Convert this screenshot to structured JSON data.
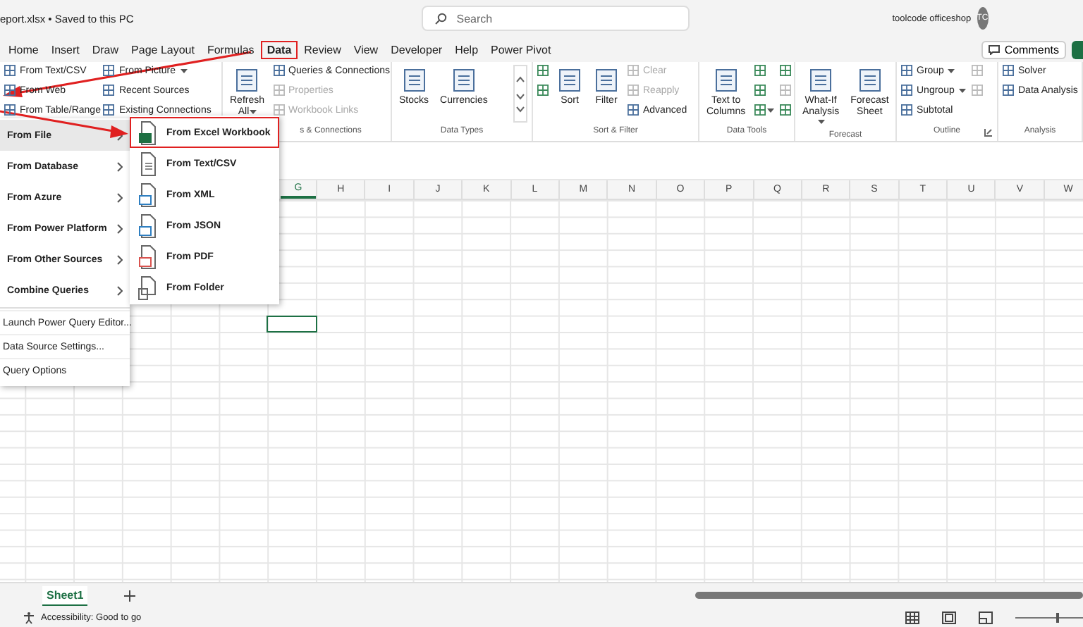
{
  "title_bar": {
    "file_title": "eport.xlsx • Saved to this PC",
    "search_placeholder": "Search",
    "user_name": "toolcode officeshop",
    "avatar_initials": "TC"
  },
  "menu_tabs": [
    {
      "label": "Home",
      "selected": false,
      "highlighted": false
    },
    {
      "label": "Insert",
      "selected": false,
      "highlighted": false
    },
    {
      "label": "Draw",
      "selected": false,
      "highlighted": false
    },
    {
      "label": "Page Layout",
      "selected": false,
      "highlighted": false
    },
    {
      "label": "Formulas",
      "selected": false,
      "highlighted": false
    },
    {
      "label": "Data",
      "selected": true,
      "highlighted": true
    },
    {
      "label": "Review",
      "selected": false,
      "highlighted": false
    },
    {
      "label": "View",
      "selected": false,
      "highlighted": false
    },
    {
      "label": "Developer",
      "selected": false,
      "highlighted": false
    },
    {
      "label": "Help",
      "selected": false,
      "highlighted": false
    },
    {
      "label": "Power Pivot",
      "selected": false,
      "highlighted": false
    }
  ],
  "comments_button": "Comments",
  "ribbon_groups": [
    {
      "columns": [
        [
          {
            "label": "From Text/CSV",
            "kind": "small",
            "disabled": false
          },
          {
            "label": "From Web",
            "kind": "small",
            "disabled": false
          },
          {
            "label": "From Table/Range",
            "kind": "small",
            "disabled": false
          }
        ],
        [
          {
            "label": "From Picture",
            "kind": "small",
            "disabled": false,
            "dropdown": true
          },
          {
            "label": "Recent Sources",
            "kind": "small",
            "disabled": false
          },
          {
            "label": "Existing Connections",
            "kind": "small",
            "disabled": false
          }
        ]
      ]
    },
    {
      "label": "s & Connections",
      "columns": [
        [
          {
            "label": "Refresh All",
            "kind": "large",
            "disabled": false,
            "dropdown": true
          }
        ],
        [
          {
            "label": "Queries & Connections",
            "kind": "small",
            "disabled": false
          },
          {
            "label": "Properties",
            "kind": "small",
            "disabled": true
          },
          {
            "label": "Workbook Links",
            "kind": "small",
            "disabled": true
          }
        ]
      ]
    },
    {
      "label": "Data Types",
      "gallery": true,
      "columns": [
        [
          {
            "label": "Stocks",
            "kind": "large",
            "disabled": false
          }
        ],
        [
          {
            "label": "Currencies",
            "kind": "large",
            "disabled": false
          }
        ]
      ]
    },
    {
      "label": "Sort & Filter",
      "columns": [
        [
          {
            "kind": "icon",
            "disabled": false
          },
          {
            "kind": "icon",
            "disabled": false
          }
        ],
        [
          {
            "label": "Sort",
            "kind": "large",
            "disabled": false
          }
        ],
        [
          {
            "label": "Filter",
            "kind": "large",
            "disabled": false
          }
        ],
        [
          {
            "label": "Clear",
            "kind": "small",
            "disabled": true
          },
          {
            "label": "Reapply",
            "kind": "small",
            "disabled": true
          },
          {
            "label": "Advanced",
            "kind": "small",
            "disabled": false
          }
        ]
      ]
    },
    {
      "label": "Data Tools",
      "columns": [
        [
          {
            "label": "Text to Columns",
            "kind": "large",
            "disabled": false
          }
        ],
        [
          {
            "kind": "icon",
            "disabled": false
          },
          {
            "kind": "icon",
            "disabled": false
          },
          {
            "kind": "icon",
            "disabled": false,
            "dropdown": true
          }
        ],
        [
          {
            "kind": "icon",
            "disabled": false
          },
          {
            "kind": "icon",
            "disabled": true
          },
          {
            "kind": "icon",
            "disabled": false
          }
        ]
      ]
    },
    {
      "label": "Forecast",
      "columns": [
        [
          {
            "label": "What-If Analysis",
            "kind": "large",
            "disabled": false,
            "dropdown": true
          }
        ],
        [
          {
            "label": "Forecast Sheet",
            "kind": "large",
            "disabled": false
          }
        ]
      ]
    },
    {
      "label": "Outline",
      "launcher": true,
      "columns": [
        [
          {
            "label": "Group",
            "kind": "small",
            "disabled": false,
            "dropdown": true
          },
          {
            "label": "Ungroup",
            "kind": "small",
            "disabled": false,
            "dropdown": true
          },
          {
            "label": "Subtotal",
            "kind": "small",
            "disabled": false
          }
        ],
        [
          {
            "kind": "icon",
            "disabled": true
          },
          {
            "kind": "icon",
            "disabled": true
          }
        ]
      ]
    },
    {
      "label": "Analysis",
      "columns": [
        [
          {
            "label": "Solver",
            "kind": "small",
            "disabled": false
          },
          {
            "label": "Data Analysis",
            "kind": "small",
            "disabled": false
          }
        ]
      ]
    }
  ],
  "get_data_menu": [
    {
      "label": "From File",
      "kind": "submenu",
      "selected": true
    },
    {
      "label": "From Database",
      "kind": "submenu",
      "selected": false
    },
    {
      "label": "From Azure",
      "kind": "submenu",
      "selected": false
    },
    {
      "label": "From Power Platform",
      "kind": "submenu",
      "selected": false
    },
    {
      "label": "From Other Sources",
      "kind": "submenu",
      "selected": false
    },
    {
      "label": "Combine Queries",
      "kind": "submenu",
      "selected": false
    },
    {
      "label": "Launch Power Query Editor...",
      "kind": "command",
      "selected": false
    },
    {
      "label": "Data Source Settings...",
      "kind": "command",
      "selected": false
    },
    {
      "label": "Query Options",
      "kind": "command",
      "selected": false
    }
  ],
  "from_file_submenu": [
    {
      "label": "From Excel Workbook",
      "kind": "excel",
      "highlighted": true
    },
    {
      "label": "From Text/CSV",
      "kind": "text",
      "highlighted": false
    },
    {
      "label": "From XML",
      "kind": "xml",
      "highlighted": false
    },
    {
      "label": "From JSON",
      "kind": "json",
      "highlighted": false
    },
    {
      "label": "From PDF",
      "kind": "pdf",
      "highlighted": false
    },
    {
      "label": "From Folder",
      "kind": "folder",
      "highlighted": false
    }
  ],
  "columns": [
    "G",
    "H",
    "I",
    "J",
    "K",
    "L",
    "M",
    "N",
    "O",
    "P",
    "Q",
    "R",
    "S",
    "T",
    "U",
    "V",
    "W"
  ],
  "sheet_tabs": [
    {
      "label": "Sheet1",
      "selected": true
    }
  ],
  "status_bar": {
    "accessibility": "Accessibility: Good to go",
    "zoom": {
      "level": 0.6
    }
  }
}
